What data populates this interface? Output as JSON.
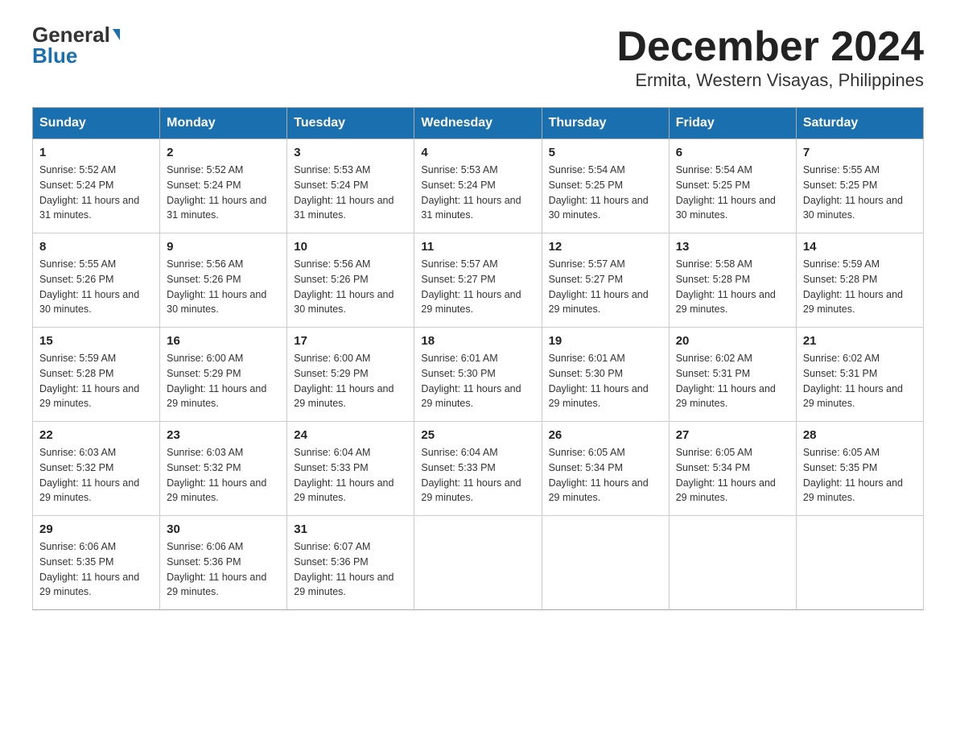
{
  "logo": {
    "general": "General",
    "blue": "Blue"
  },
  "title": "December 2024",
  "subtitle": "Ermita, Western Visayas, Philippines",
  "weekdays": [
    "Sunday",
    "Monday",
    "Tuesday",
    "Wednesday",
    "Thursday",
    "Friday",
    "Saturday"
  ],
  "weeks": [
    [
      {
        "day": "1",
        "sunrise": "5:52 AM",
        "sunset": "5:24 PM",
        "daylight": "11 hours and 31 minutes."
      },
      {
        "day": "2",
        "sunrise": "5:52 AM",
        "sunset": "5:24 PM",
        "daylight": "11 hours and 31 minutes."
      },
      {
        "day": "3",
        "sunrise": "5:53 AM",
        "sunset": "5:24 PM",
        "daylight": "11 hours and 31 minutes."
      },
      {
        "day": "4",
        "sunrise": "5:53 AM",
        "sunset": "5:24 PM",
        "daylight": "11 hours and 31 minutes."
      },
      {
        "day": "5",
        "sunrise": "5:54 AM",
        "sunset": "5:25 PM",
        "daylight": "11 hours and 30 minutes."
      },
      {
        "day": "6",
        "sunrise": "5:54 AM",
        "sunset": "5:25 PM",
        "daylight": "11 hours and 30 minutes."
      },
      {
        "day": "7",
        "sunrise": "5:55 AM",
        "sunset": "5:25 PM",
        "daylight": "11 hours and 30 minutes."
      }
    ],
    [
      {
        "day": "8",
        "sunrise": "5:55 AM",
        "sunset": "5:26 PM",
        "daylight": "11 hours and 30 minutes."
      },
      {
        "day": "9",
        "sunrise": "5:56 AM",
        "sunset": "5:26 PM",
        "daylight": "11 hours and 30 minutes."
      },
      {
        "day": "10",
        "sunrise": "5:56 AM",
        "sunset": "5:26 PM",
        "daylight": "11 hours and 30 minutes."
      },
      {
        "day": "11",
        "sunrise": "5:57 AM",
        "sunset": "5:27 PM",
        "daylight": "11 hours and 29 minutes."
      },
      {
        "day": "12",
        "sunrise": "5:57 AM",
        "sunset": "5:27 PM",
        "daylight": "11 hours and 29 minutes."
      },
      {
        "day": "13",
        "sunrise": "5:58 AM",
        "sunset": "5:28 PM",
        "daylight": "11 hours and 29 minutes."
      },
      {
        "day": "14",
        "sunrise": "5:59 AM",
        "sunset": "5:28 PM",
        "daylight": "11 hours and 29 minutes."
      }
    ],
    [
      {
        "day": "15",
        "sunrise": "5:59 AM",
        "sunset": "5:28 PM",
        "daylight": "11 hours and 29 minutes."
      },
      {
        "day": "16",
        "sunrise": "6:00 AM",
        "sunset": "5:29 PM",
        "daylight": "11 hours and 29 minutes."
      },
      {
        "day": "17",
        "sunrise": "6:00 AM",
        "sunset": "5:29 PM",
        "daylight": "11 hours and 29 minutes."
      },
      {
        "day": "18",
        "sunrise": "6:01 AM",
        "sunset": "5:30 PM",
        "daylight": "11 hours and 29 minutes."
      },
      {
        "day": "19",
        "sunrise": "6:01 AM",
        "sunset": "5:30 PM",
        "daylight": "11 hours and 29 minutes."
      },
      {
        "day": "20",
        "sunrise": "6:02 AM",
        "sunset": "5:31 PM",
        "daylight": "11 hours and 29 minutes."
      },
      {
        "day": "21",
        "sunrise": "6:02 AM",
        "sunset": "5:31 PM",
        "daylight": "11 hours and 29 minutes."
      }
    ],
    [
      {
        "day": "22",
        "sunrise": "6:03 AM",
        "sunset": "5:32 PM",
        "daylight": "11 hours and 29 minutes."
      },
      {
        "day": "23",
        "sunrise": "6:03 AM",
        "sunset": "5:32 PM",
        "daylight": "11 hours and 29 minutes."
      },
      {
        "day": "24",
        "sunrise": "6:04 AM",
        "sunset": "5:33 PM",
        "daylight": "11 hours and 29 minutes."
      },
      {
        "day": "25",
        "sunrise": "6:04 AM",
        "sunset": "5:33 PM",
        "daylight": "11 hours and 29 minutes."
      },
      {
        "day": "26",
        "sunrise": "6:05 AM",
        "sunset": "5:34 PM",
        "daylight": "11 hours and 29 minutes."
      },
      {
        "day": "27",
        "sunrise": "6:05 AM",
        "sunset": "5:34 PM",
        "daylight": "11 hours and 29 minutes."
      },
      {
        "day": "28",
        "sunrise": "6:05 AM",
        "sunset": "5:35 PM",
        "daylight": "11 hours and 29 minutes."
      }
    ],
    [
      {
        "day": "29",
        "sunrise": "6:06 AM",
        "sunset": "5:35 PM",
        "daylight": "11 hours and 29 minutes."
      },
      {
        "day": "30",
        "sunrise": "6:06 AM",
        "sunset": "5:36 PM",
        "daylight": "11 hours and 29 minutes."
      },
      {
        "day": "31",
        "sunrise": "6:07 AM",
        "sunset": "5:36 PM",
        "daylight": "11 hours and 29 minutes."
      },
      null,
      null,
      null,
      null
    ]
  ],
  "labels": {
    "sunrise": "Sunrise: ",
    "sunset": "Sunset: ",
    "daylight": "Daylight: "
  }
}
